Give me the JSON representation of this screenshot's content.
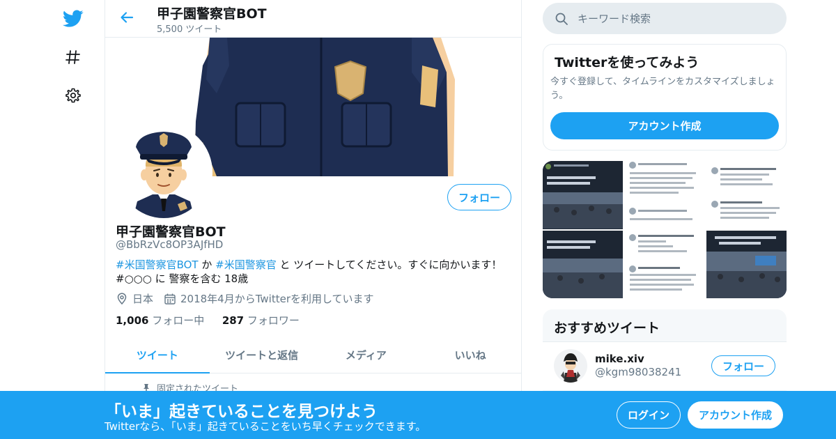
{
  "nav": {
    "icons": [
      "twitter-bird-icon",
      "hashtag-icon",
      "gear-icon"
    ]
  },
  "header": {
    "title": "甲子園警察官BOT",
    "tweet_count": "5,500 ツイート"
  },
  "profile": {
    "name": "甲子園警察官BOT",
    "handle": "@BbRzVc8OP3AJfHD",
    "follow_label": "フォロー",
    "bio": {
      "hashtag1": "#米国警察官BOT",
      "text1": " か ",
      "hashtag2": "#米国警察官",
      "text2": " と ツイートしてください。すぐに向かいます！",
      "line2": "#○○○ に 警察を含む  18歳"
    },
    "location": "日本",
    "joined": "2018年4月からTwitterを利用しています",
    "following_count": "1,006",
    "following_label": "フォロー中",
    "followers_count": "287",
    "followers_label": "フォロワー"
  },
  "tabs": [
    {
      "label": "ツイート",
      "active": true
    },
    {
      "label": "ツイートと返信",
      "active": false
    },
    {
      "label": "メディア",
      "active": false
    },
    {
      "label": "いいね",
      "active": false
    }
  ],
  "pinned_label": "固定されたツイート",
  "sidebar": {
    "search_placeholder": "キーワード検索",
    "signup_card": {
      "title": "Twitterを使ってみよう",
      "text": "今すぐ登録して、タイムラインをカスタマイズしましょう。",
      "button": "アカウント作成"
    },
    "recommend": {
      "title": "おすすめツイート",
      "user": {
        "name": "mike.xiv",
        "handle": "@kgm98038241",
        "follow_label": "フォロー"
      }
    }
  },
  "bottom_bar": {
    "title": "「いま」起きていることを見つけよう",
    "subtitle": "Twitterなら、「いま」起きていることをいち早くチェックできます。",
    "login": "ログイン",
    "signup": "アカウント作成"
  },
  "colors": {
    "accent": "#1da1f2",
    "link": "#1b95e0",
    "secondary_text": "#657786",
    "border": "#e6ecf0",
    "uniform": "#1e2d52"
  }
}
